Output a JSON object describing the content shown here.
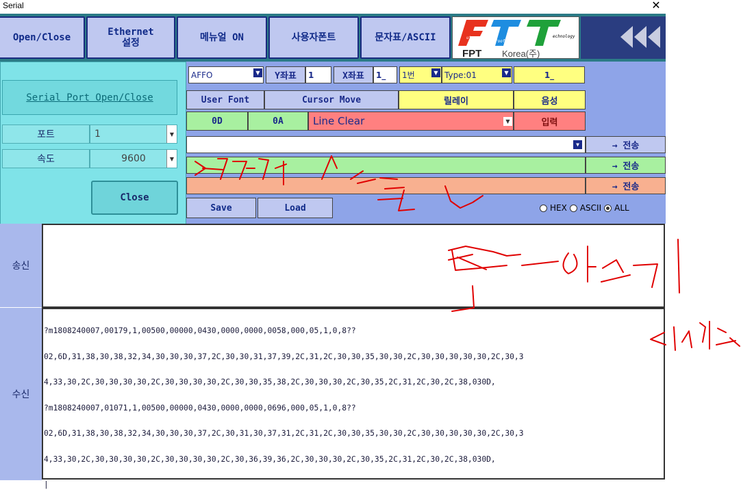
{
  "window": {
    "title": "Serial"
  },
  "toolbar": {
    "open_close": "Open/Close",
    "ethernet": "Ethernet\n설정",
    "manual": "메뉴얼 ON",
    "user_font": "사용자폰트",
    "charset": "문자표/ASCII",
    "logo_brand": "FPT",
    "logo_sub": "Korea(주)",
    "logo_tagline": [
      "uture",
      "roof",
      "echnology"
    ]
  },
  "serial_panel": {
    "port_open_close": "Serial Port Open/Close",
    "port_label": "포트",
    "port_value": "1",
    "speed_label": "속도",
    "speed_value": "9600",
    "close": "Close"
  },
  "controls": {
    "font_select": "AFFO",
    "y_label": "Y좌표",
    "y_value": "1",
    "x_label": "X좌표",
    "x_value": "1_",
    "num_select": "1번",
    "type_select": "Type:01",
    "right_value": "1_",
    "user_font_btn": "User Font",
    "cursor_move": "Cursor Move",
    "relay": "릴레이",
    "voice": "음성",
    "od": "0D",
    "oa": "0A",
    "line_clear": "Line Clear",
    "input": "입력",
    "send_label": "→ 전송",
    "save": "Save",
    "load": "Load",
    "radio": [
      {
        "label": "HEX",
        "checked": false
      },
      {
        "label": "ASCII",
        "checked": false
      },
      {
        "label": "ALL",
        "checked": true
      }
    ]
  },
  "send_area": {
    "label": "송신"
  },
  "recv_area": {
    "label": "수신",
    "lines": [
      "?m1808240007,00179,1,00500,00000,0430,0000,0000,0058,000,05,1,0,8??",
      "02,6D,31,38,30,38,32,34,30,30,30,37,2C,30,30,31,37,39,2C,31,2C,30,30,35,30,30,2C,30,30,30,30,30,2C,30,3",
      "4,33,30,2C,30,30,30,30,2C,30,30,30,30,2C,30,30,35,38,2C,30,30,30,2C,30,35,2C,31,2C,30,2C,38,030D,",
      "?m1808240007,01071,1,00500,00000,0430,0000,0000,0696,000,05,1,0,8??",
      "02,6D,31,38,30,38,32,34,30,30,30,37,2C,30,31,30,37,31,2C,31,2C,30,30,35,30,30,2C,30,30,30,30,30,2C,30,3",
      "4,33,30,2C,30,30,30,30,2C,30,30,30,30,2C,30,36,39,36,2C,30,30,30,2C,30,35,2C,31,2C,30,2C,38,030D,",
      "|"
    ]
  },
  "colors": {
    "toolbar_bg": "#2b7b86",
    "toolbar_btn": "#bfc8f0",
    "panel_bg": "#8ea4e8",
    "side_panel": "#7fe3e8",
    "yellow": "#ffff80",
    "green": "#a8f0a0",
    "salmon": "#f8b090",
    "red": "#ff8080",
    "ink": "#e00000"
  }
}
